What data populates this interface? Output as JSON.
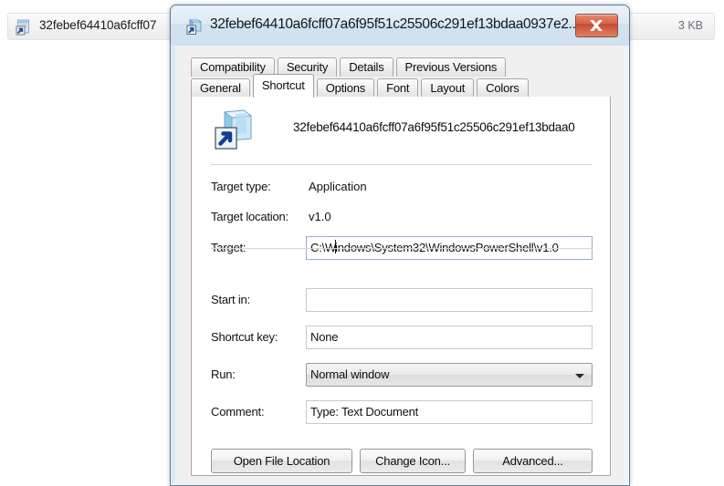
{
  "background_window": {
    "file_row": {
      "icon": "text-document-shortcut-icon",
      "name": "32febef64410a6fcff07",
      "size": "3 KB"
    }
  },
  "dialog": {
    "title": "32febef64410a6fcff07a6f95f51c25506c291ef13bdaa0937e2...",
    "title_icon": "shortcut-file-icon",
    "close_label": "Close",
    "tabs_row1": [
      {
        "label": "Compatibility",
        "selected": false
      },
      {
        "label": "Security",
        "selected": false
      },
      {
        "label": "Details",
        "selected": false
      },
      {
        "label": "Previous Versions",
        "selected": false
      }
    ],
    "tabs_row2": [
      {
        "label": "General",
        "selected": false
      },
      {
        "label": "Shortcut",
        "selected": true
      },
      {
        "label": "Options",
        "selected": false
      },
      {
        "label": "Font",
        "selected": false
      },
      {
        "label": "Layout",
        "selected": false
      },
      {
        "label": "Colors",
        "selected": false
      }
    ],
    "header": {
      "icon": "powershell-shortcut-icon",
      "name": "32febef64410a6fcff07a6f95f51c25506c291ef13bdaa0"
    },
    "fields": {
      "target_type_label": "Target type:",
      "target_type_value": "Application",
      "target_location_label": "Target location:",
      "target_location_value": "v1.0",
      "target_label": "Target:",
      "target_value_before_caret": "C:\\W",
      "target_value_after_caret": "indows\\System32\\WindowsPowerShell\\v1.0",
      "start_in_label": "Start in:",
      "start_in_value": "",
      "shortcut_key_label": "Shortcut key:",
      "shortcut_key_value": "None",
      "run_label": "Run:",
      "run_value": "Normal window",
      "comment_label": "Comment:",
      "comment_value": "Type: Text Document"
    },
    "buttons": {
      "open_file_location": "Open File Location",
      "change_icon": "Change Icon...",
      "advanced": "Advanced..."
    }
  },
  "colors": {
    "titlebar_start": "#eaf2f9",
    "titlebar_end": "#cfe0ef",
    "close_button": "#d8604a",
    "dialog_border": "#5c7b93",
    "client_bg": "#f0f0f0",
    "page_bg": "#ffffff"
  }
}
